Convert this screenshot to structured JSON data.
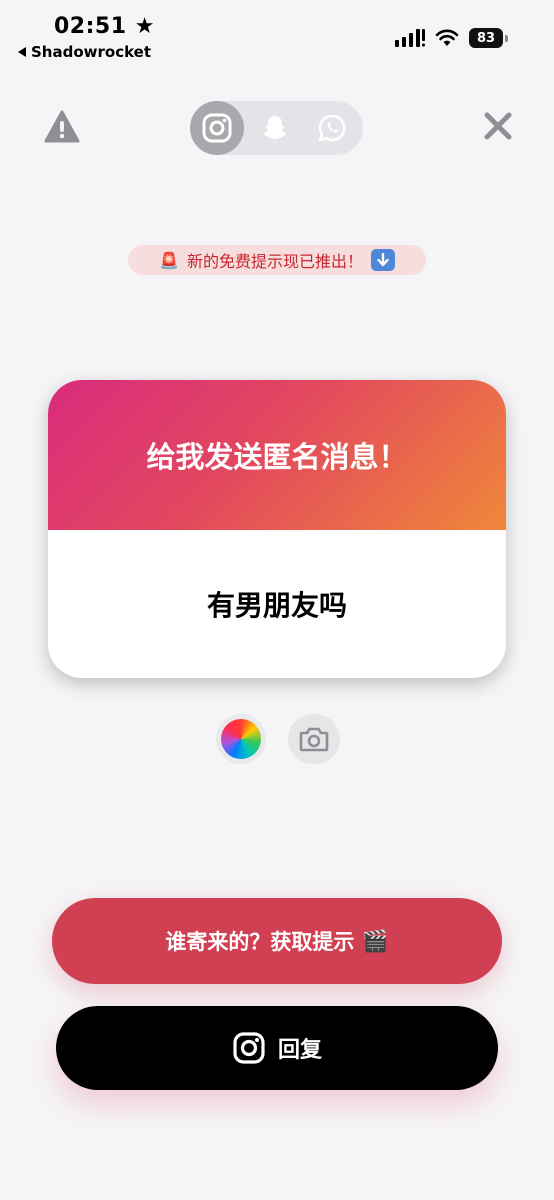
{
  "status_bar": {
    "time": "02:51",
    "time_suffix": "★",
    "back_label": "Shadowrocket",
    "battery": "83"
  },
  "header": {
    "tabs": [
      {
        "icon": "instagram-icon",
        "active": true
      },
      {
        "icon": "snapchat-icon",
        "active": false
      },
      {
        "icon": "whatsapp-icon",
        "active": false
      }
    ]
  },
  "promo": {
    "leading_emoji": "🚨",
    "text": "新的免费提示现已推出！"
  },
  "card": {
    "title": "给我发送匿名消息！",
    "message": "有男朋友吗"
  },
  "tools": {
    "color_icon": "color-wheel-icon",
    "camera_icon": "camera-icon"
  },
  "buttons": {
    "hint_label": "谁寄来的？获取提示",
    "hint_emoji": "🎬",
    "reply_label": "回复"
  },
  "colors": {
    "gradient_start": "#d92b7d",
    "gradient_end": "#f0873a",
    "hint_button": "#d03f52",
    "reply_button": "#000000"
  }
}
